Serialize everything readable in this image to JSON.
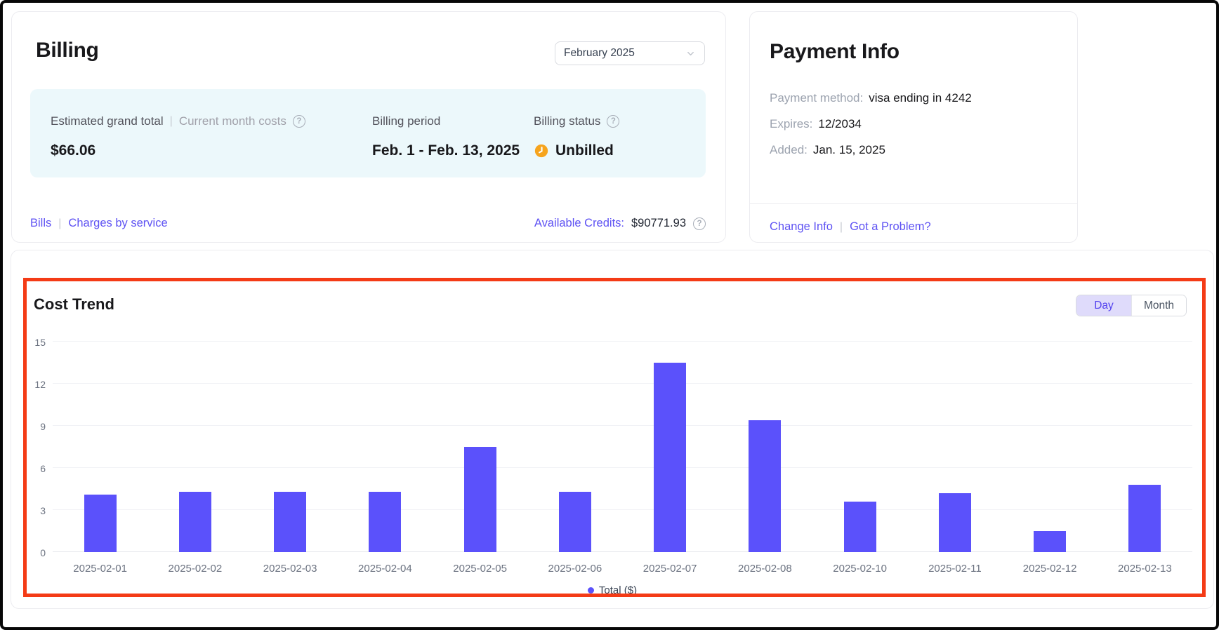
{
  "ui": {
    "separator": "|"
  },
  "icons": {
    "help_glyph": "?"
  },
  "billing": {
    "title": "Billing",
    "month_selector": {
      "value": "February 2025"
    },
    "summary": {
      "grand_total_label": "Estimated grand total",
      "current_month_label": "Current month costs",
      "grand_total_value": "$66.06",
      "billing_period_label": "Billing period",
      "billing_period_value": "Feb. 1 - Feb. 13, 2025",
      "billing_status_label": "Billing status",
      "billing_status_value": "Unbilled"
    },
    "links": {
      "bills": "Bills",
      "charges": "Charges by service"
    },
    "credits": {
      "label": "Available Credits:",
      "value": "$90771.93"
    }
  },
  "payment": {
    "title": "Payment Info",
    "rows": [
      {
        "label": "Payment method:",
        "value": "visa ending in 4242"
      },
      {
        "label": "Expires:",
        "value": "12/2034"
      },
      {
        "label": "Added:",
        "value": "Jan. 15, 2025"
      }
    ],
    "links": {
      "change": "Change Info",
      "problem": "Got a Problem?"
    }
  },
  "cost_trend": {
    "title": "Cost Trend",
    "toggle": {
      "day": "Day",
      "month": "Month",
      "selected": "Day"
    }
  },
  "chart_data": {
    "type": "bar",
    "title": "Cost Trend",
    "categories": [
      "2025-02-01",
      "2025-02-02",
      "2025-02-03",
      "2025-02-04",
      "2025-02-05",
      "2025-02-06",
      "2025-02-07",
      "2025-02-08",
      "2025-02-10",
      "2025-02-11",
      "2025-02-12",
      "2025-02-13"
    ],
    "values": [
      4.1,
      4.3,
      4.3,
      4.3,
      7.5,
      4.3,
      13.5,
      9.4,
      3.6,
      4.2,
      1.5,
      4.8
    ],
    "xlabel": "",
    "ylabel": "",
    "ylim": [
      0,
      15
    ],
    "yticks": [
      0,
      3,
      6,
      9,
      12,
      15
    ],
    "grid": true,
    "legend": "Total ($)",
    "legend_position": "bottom",
    "bar_color": "#5b51fb"
  },
  "colors": {
    "accent_purple": "#5e52f3",
    "bar_purple": "#5b51fb",
    "summary_bg": "#ecf8fb",
    "status_clock_orange": "#f6a41d",
    "annotation_red": "#f43b16",
    "toggle_selected_bg": "#dfdbfb"
  }
}
